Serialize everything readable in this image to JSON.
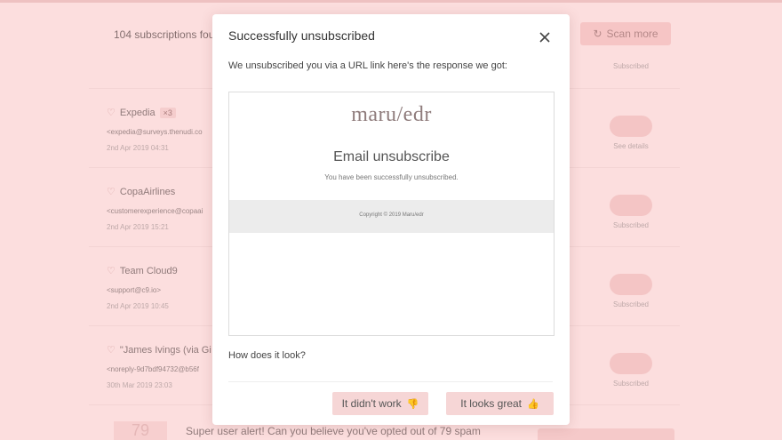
{
  "background": {
    "subscriptions_count": "104 subscriptions four",
    "scan_more_label": "Scan more",
    "rows": [
      {
        "name": "",
        "badge": "",
        "email": "",
        "date": "",
        "status": "Subscribed"
      },
      {
        "name": "Expedia",
        "badge": "×3",
        "email": "<expedia@surveys.thenudi.co",
        "date": "2nd Apr 2019 04:31",
        "status": "See details"
      },
      {
        "name": "CopaAirlines",
        "badge": "",
        "email": "<customerexperience@copaai",
        "date": "2nd Apr 2019 15:21",
        "status": "Subscribed"
      },
      {
        "name": "Team Cloud9",
        "badge": "",
        "email": "<support@c9.io>",
        "date": "2nd Apr 2019 10:45",
        "status": "Subscribed"
      },
      {
        "name": "\"James Ivings (via Gi",
        "badge": "",
        "email": "<noreply-9d7bdf94732@b56f",
        "date": "30th Mar 2019 23:03",
        "status": "Subscribed"
      }
    ],
    "footer_number": "79",
    "footer_text": "Super user alert! Can you believe you've opted out of 79 spam"
  },
  "modal": {
    "title": "Successfully unsubscribed",
    "description": "We unsubscribed you via a URL link here's the response we got:",
    "response": {
      "brand": "maru/edr",
      "heading": "Email unsubscribe",
      "message": "You have been successfully unsubscribed.",
      "copyright": "Copyright © 2019 Maru/edr"
    },
    "question": "How does it look?",
    "no_label": "It didn't work",
    "yes_label": "It looks great"
  }
}
